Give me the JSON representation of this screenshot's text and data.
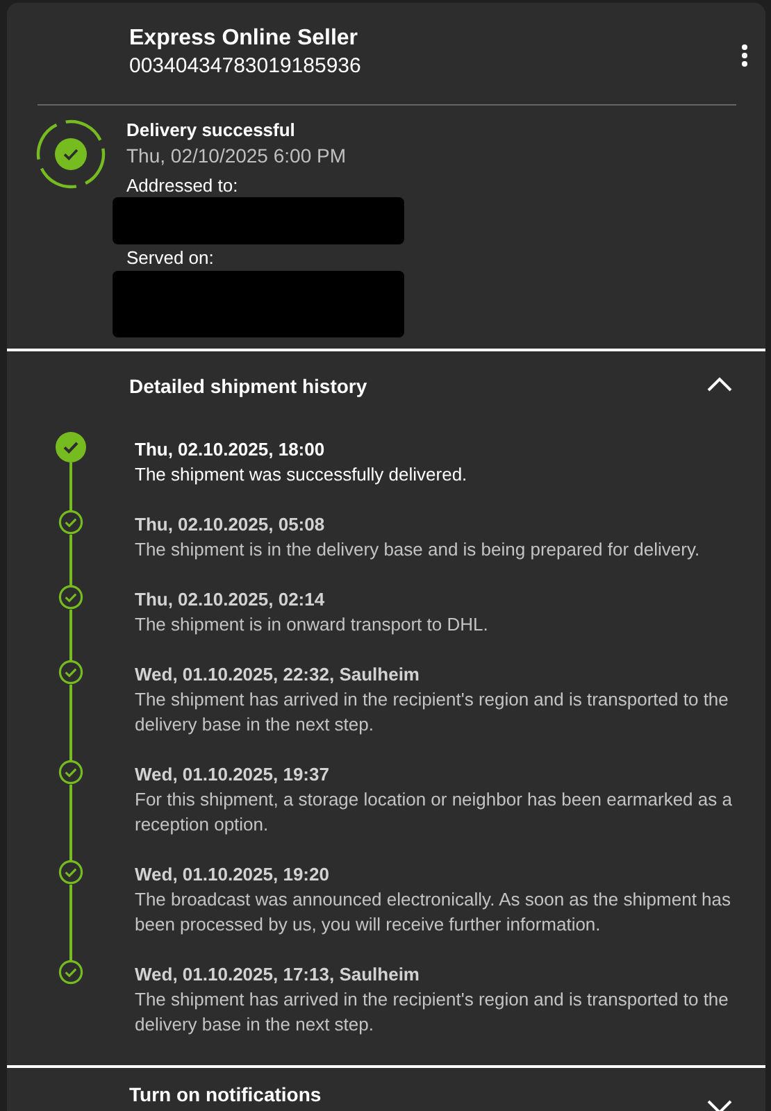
{
  "shipment": {
    "sender": "Express Online Seller",
    "tracking_number": "00340434783019185936"
  },
  "status": {
    "title": "Delivery successful",
    "date": "Thu, 02/10/2025 6:00 PM",
    "delivered": true,
    "fields": [
      {
        "label": "Addressed to:",
        "redacted": true
      },
      {
        "label": "Served on:",
        "redacted": true
      }
    ]
  },
  "history": {
    "title": "Detailed shipment history",
    "expanded": true,
    "events": [
      {
        "date": "Thu, 02.10.2025, 18:00",
        "text": "The shipment was successfully delivered.",
        "current": true
      },
      {
        "date": "Thu, 02.10.2025, 05:08",
        "text": "The shipment is in the delivery base and is being prepared for delivery.",
        "current": false
      },
      {
        "date": "Thu, 02.10.2025, 02:14",
        "text": "The shipment is in onward transport to DHL.",
        "current": false
      },
      {
        "date": "Wed, 01.10.2025, 22:32, Saulheim",
        "text": "The shipment has arrived in the recipient's region and is transported to the delivery base in the next step.",
        "current": false
      },
      {
        "date": "Wed, 01.10.2025, 19:37",
        "text": "For this shipment, a storage location or neighbor has been earmarked as a reception option.",
        "current": false
      },
      {
        "date": "Wed, 01.10.2025, 19:20",
        "text": "The broadcast was announced electronically. As soon as the shipment has been processed by us, you will receive further information.",
        "current": false
      },
      {
        "date": "Wed, 01.10.2025, 17:13, Saulheim",
        "text": "The shipment has arrived in the recipient's region and is transported to the delivery base in the next step.",
        "current": false
      }
    ]
  },
  "notifications": {
    "title": "Turn on notifications",
    "expanded": false
  }
}
